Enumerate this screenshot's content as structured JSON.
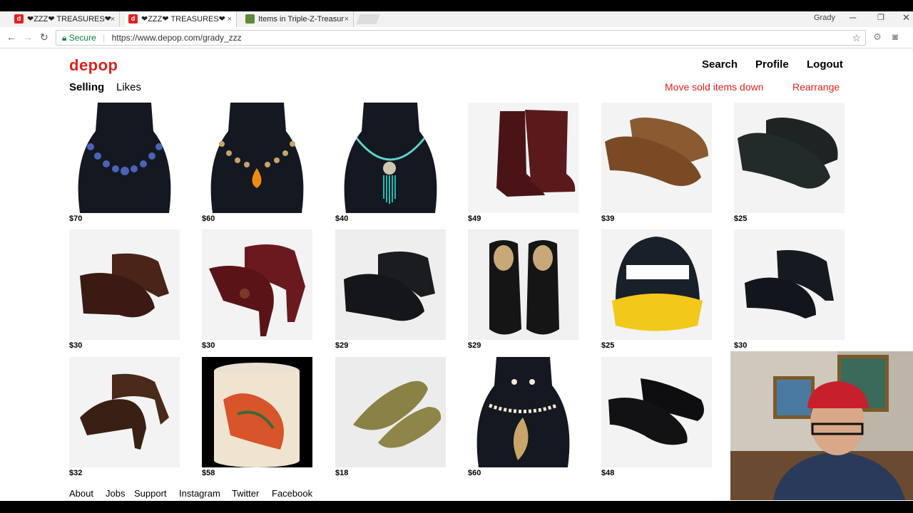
{
  "browser": {
    "tabs": [
      {
        "label": "❤ZZZ❤ TREASURES❤",
        "favicon": "d",
        "active": false
      },
      {
        "label": "❤ZZZ❤ TREASURES❤",
        "favicon": "d",
        "active": true
      },
      {
        "label": "Items in Triple-Z-Treasur",
        "favicon": "ebay",
        "active": false
      }
    ],
    "user_name": "Grady",
    "secure_label": "Secure",
    "url": "https://www.depop.com/grady_zzz"
  },
  "header": {
    "logo": "depop",
    "nav": [
      "Search",
      "Profile",
      "Logout"
    ],
    "subnav": [
      "Selling",
      "Likes"
    ],
    "actions": [
      "Move sold items down",
      "Rearrange"
    ]
  },
  "items": [
    {
      "price": "$70",
      "kind": "necklace-blue"
    },
    {
      "price": "$60",
      "kind": "necklace-amber"
    },
    {
      "price": "$40",
      "kind": "necklace-turquoise"
    },
    {
      "price": "$49",
      "kind": "boots"
    },
    {
      "price": "$39",
      "kind": "clogs-brown"
    },
    {
      "price": "$25",
      "kind": "clogs-black"
    },
    {
      "price": "$30",
      "kind": "mules-brown"
    },
    {
      "price": "$30",
      "kind": "heels-burgundy"
    },
    {
      "price": "$29",
      "kind": "shoes-black"
    },
    {
      "price": "$29",
      "kind": "loafers-black"
    },
    {
      "price": "$25",
      "kind": "cap"
    },
    {
      "price": "$30",
      "kind": "heels-black"
    },
    {
      "price": "$32",
      "kind": "mules-woven"
    },
    {
      "price": "$58",
      "kind": "jar"
    },
    {
      "price": "$18",
      "kind": "flats-olive"
    },
    {
      "price": "$60",
      "kind": "necklace-pearl"
    },
    {
      "price": "$48",
      "kind": "oxfords-black"
    }
  ],
  "footer": [
    "About",
    "Jobs",
    "Support",
    "Instagram",
    "Twitter",
    "Facebook"
  ],
  "colors": {
    "brand": "#e0221e"
  }
}
